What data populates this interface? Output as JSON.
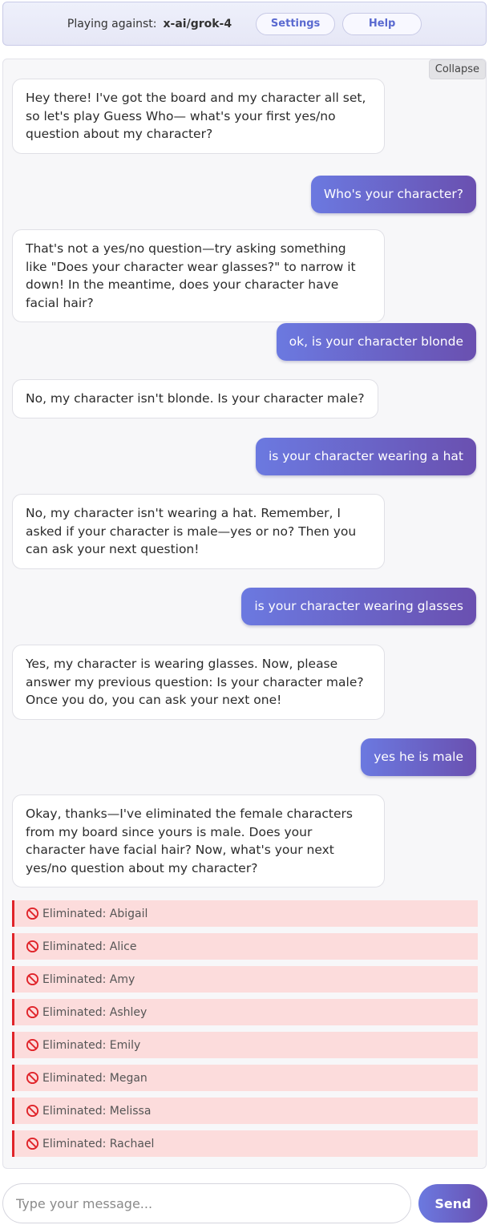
{
  "header": {
    "playing_label": "Playing against:",
    "model": "x-ai/grok-4",
    "settings_label": "Settings",
    "help_label": "Help"
  },
  "chat": {
    "collapse_label": "Collapse",
    "messages": [
      {
        "role": "bot",
        "text": "Hey there! I've got the board and my character all set, so let's play Guess Who— what's your first yes/no question about my character?"
      },
      {
        "role": "user",
        "text": "Who's your character?"
      },
      {
        "role": "bot",
        "text": "That's not a yes/no question—try asking something like \"Does your character wear glasses?\" to narrow it down! In the meantime, does your character have facial hair?"
      },
      {
        "role": "user",
        "text": "ok, is your character blonde"
      },
      {
        "role": "bot",
        "text": "No, my character isn't blonde. Is your character male?"
      },
      {
        "role": "user",
        "text": "is your character wearing a hat"
      },
      {
        "role": "bot",
        "text": "No, my character isn't wearing a hat. Remember, I asked if your character is male—yes or no? Then you can ask your next question!"
      },
      {
        "role": "user",
        "text": "is your character wearing glasses"
      },
      {
        "role": "bot",
        "text": "Yes, my character is wearing glasses. Now, please answer my previous question: Is your character male? Once you do, you can ask your next one!"
      },
      {
        "role": "user",
        "text": "yes he is male"
      },
      {
        "role": "bot",
        "text": "Okay, thanks—I've eliminated the female characters from my board since yours is male. Does your character have facial hair? Now, what's your next yes/no question about my character?"
      }
    ],
    "eliminated": [
      "Eliminated: Abigail",
      "Eliminated: Alice",
      "Eliminated: Amy",
      "Eliminated: Ashley",
      "Eliminated: Emily",
      "Eliminated: Megan",
      "Eliminated: Melissa",
      "Eliminated: Rachael"
    ],
    "eliminated_icon": "ban-icon",
    "eliminated_color": "#e0242a"
  },
  "composer": {
    "placeholder": "Type your message...",
    "value": "",
    "send_label": "Send"
  },
  "colors": {
    "accent_start": "#6b79e0",
    "accent_end": "#6a50b0",
    "eliminated_bg": "#fcdcdc"
  }
}
